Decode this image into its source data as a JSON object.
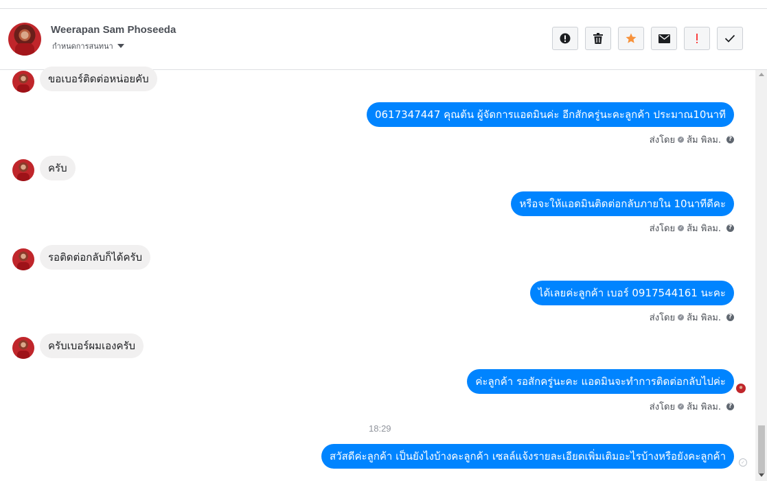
{
  "contact": {
    "name": "Weerapan Sam Phoseeda",
    "subtitle": "กำหนดการสนทนา"
  },
  "toolbar": [
    {
      "name": "info-button",
      "icon": "info-icon"
    },
    {
      "name": "delete-button",
      "icon": "trash-icon"
    },
    {
      "name": "star-button",
      "icon": "star-icon"
    },
    {
      "name": "mark-unread-button",
      "icon": "envelope-icon"
    },
    {
      "name": "flag-button",
      "icon": "exclamation-icon"
    },
    {
      "name": "done-button",
      "icon": "check-icon"
    }
  ],
  "colors": {
    "outgoing_bubble": "#0084ff",
    "incoming_bubble": "#f1f0f0",
    "star": "#f7923b",
    "flag": "#fa3e3e"
  },
  "messages": [
    {
      "dir": "in",
      "text": "ขอเบอร์ติดต่อหน่อยคับ"
    },
    {
      "dir": "out",
      "text": "0617347447 คุณต้น ผู้จัดการแอดมินค่ะ อีกสักครู่นะคะลูกค้า ประมาณ10นาที"
    },
    {
      "dir": "in",
      "text": "ครับ"
    },
    {
      "dir": "out",
      "text": "หรือจะให้แอดมินติดต่อกลับภายใน 10นาทีดีคะ"
    },
    {
      "dir": "in",
      "text": "รอติดต่อกลับก็ได้ครับ"
    },
    {
      "dir": "out",
      "text": "ได้เลยค่ะลูกค้า เบอร์ 0917544161 นะคะ"
    },
    {
      "dir": "in",
      "text": "ครับเบอร์ผมเองครับ"
    },
    {
      "dir": "out",
      "text": "ค่ะลูกค้า รอสักครู่นะคะ แอดมินจะทำการติดต่อกลับไปค่ะ"
    },
    {
      "dir": "out",
      "text": "สวัสดีค่ะลูกค้า เป็นยังไงบ้างคะลูกค้า เซลล์แจ้งรายละเอียดเพิ่มเติมอะไรบ้างหรือยังคะลูกค้า"
    }
  ],
  "sent_by": {
    "prefix": "ส่งโดย",
    "sender": "ส้ม พิลม."
  },
  "timestamp": "18:29"
}
